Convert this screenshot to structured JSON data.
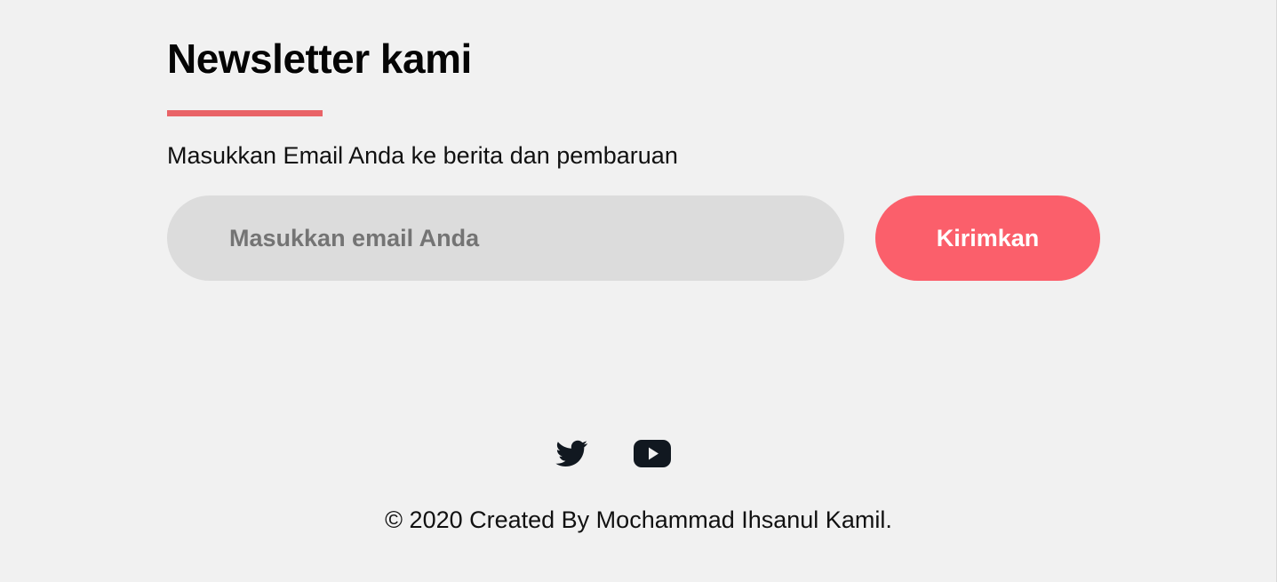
{
  "newsletter": {
    "title": "Newsletter kami",
    "subtitle": "Masukkan Email Anda ke berita dan pembaruan",
    "email_placeholder": "Masukkan email Anda",
    "email_value": "",
    "submit_label": "Kirimkan"
  },
  "social": {
    "items": [
      {
        "name": "twitter",
        "icon": "twitter-icon"
      },
      {
        "name": "youtube",
        "icon": "youtube-icon"
      }
    ]
  },
  "footer": {
    "text": "© 2020 Created By Mochammad Ihsanul Kamil."
  },
  "colors": {
    "background": "#f1f1f1",
    "accent": "#e96367",
    "input_background": "#dcdcdc",
    "button_background": "#fb5f6b",
    "text": "#111111",
    "icon": "#111820"
  }
}
